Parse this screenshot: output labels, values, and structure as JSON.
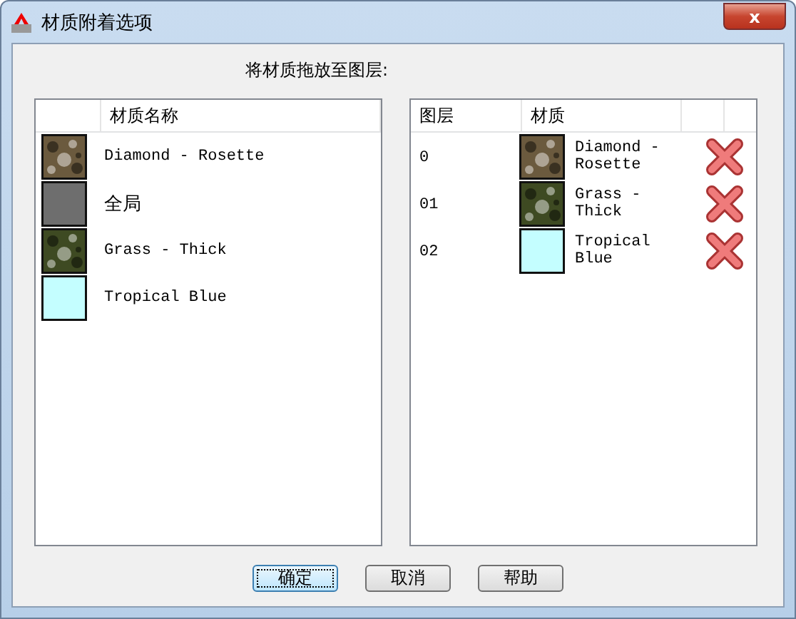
{
  "window": {
    "title": "材质附着选项",
    "close": "x"
  },
  "instruction": "将材质拖放至图层:",
  "materials": {
    "columns": [
      "材质名称"
    ],
    "rows": [
      {
        "name": "Diamond - Rosette",
        "kind": "texture",
        "color": "#6b5a3e"
      },
      {
        "name": "全局",
        "kind": "solid",
        "color": "#6e6e6e"
      },
      {
        "name": "Grass - Thick",
        "kind": "texture",
        "color": "#3e4a22"
      },
      {
        "name": "Tropical Blue",
        "kind": "solid",
        "color": "#c4feff"
      }
    ]
  },
  "layers": {
    "columns": [
      "图层",
      "材质"
    ],
    "rows": [
      {
        "layer": "0",
        "material": "Diamond - Rosette",
        "kind": "texture",
        "color": "#6b5a3e"
      },
      {
        "layer": "01",
        "material": "Grass - Thick",
        "kind": "texture",
        "color": "#3e4a22"
      },
      {
        "layer": "02",
        "material": "Tropical Blue",
        "kind": "solid",
        "color": "#c4feff"
      }
    ]
  },
  "buttons": [
    {
      "label": "确定",
      "focused": true
    },
    {
      "label": "取消",
      "focused": false
    },
    {
      "label": "帮助",
      "focused": false
    }
  ]
}
